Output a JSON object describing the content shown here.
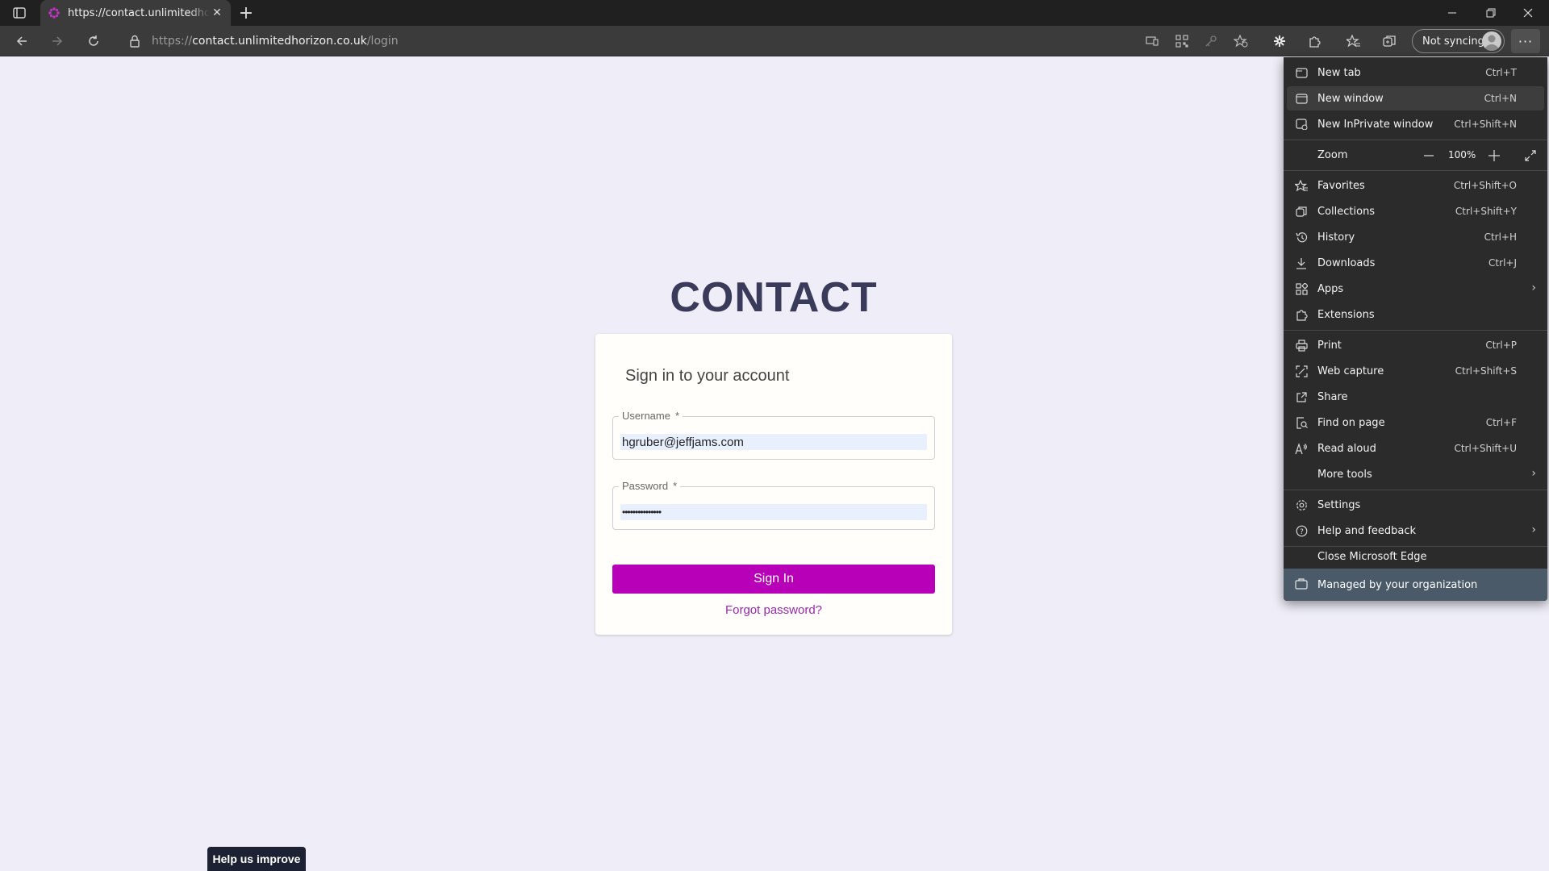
{
  "browser": {
    "tab_title": "https://contact.unlimitedhorizon.co.uk/login",
    "address_scheme": "https://",
    "address_host": "contact.unlimitedhorizon.co.uk",
    "address_path": "/login",
    "sync_label": "Not syncing",
    "more_label": "···"
  },
  "page": {
    "brand": "CONTACT",
    "card_title": "Sign in to your account",
    "username_label": "Username",
    "username_required": "*",
    "username_value": "hgruber@jeffjams.com",
    "password_label": "Password",
    "password_required": "*",
    "password_value": "•••••••••••••••",
    "signin_label": "Sign In",
    "forgot_label": "Forgot password?",
    "help_label": "Help us improve"
  },
  "menu": {
    "new_tab": {
      "label": "New tab",
      "shortcut": "Ctrl+T"
    },
    "new_window": {
      "label": "New window",
      "shortcut": "Ctrl+N"
    },
    "new_inprivate": {
      "label": "New InPrivate window",
      "shortcut": "Ctrl+Shift+N"
    },
    "zoom": {
      "label": "Zoom",
      "value": "100%"
    },
    "favorites": {
      "label": "Favorites",
      "shortcut": "Ctrl+Shift+O"
    },
    "collections": {
      "label": "Collections",
      "shortcut": "Ctrl+Shift+Y"
    },
    "history": {
      "label": "History",
      "shortcut": "Ctrl+H"
    },
    "downloads": {
      "label": "Downloads",
      "shortcut": "Ctrl+J"
    },
    "apps": {
      "label": "Apps"
    },
    "extensions": {
      "label": "Extensions"
    },
    "print": {
      "label": "Print",
      "shortcut": "Ctrl+P"
    },
    "web_capture": {
      "label": "Web capture",
      "shortcut": "Ctrl+Shift+S"
    },
    "share": {
      "label": "Share"
    },
    "find": {
      "label": "Find on page",
      "shortcut": "Ctrl+F"
    },
    "read_aloud": {
      "label": "Read aloud",
      "shortcut": "Ctrl+Shift+U"
    },
    "more_tools": {
      "label": "More tools"
    },
    "settings": {
      "label": "Settings"
    },
    "help": {
      "label": "Help and feedback"
    },
    "close": {
      "label": "Close Microsoft Edge"
    },
    "managed": {
      "label": "Managed by your organization"
    }
  },
  "colors": {
    "accent": "#b800b8",
    "link": "#9c27b0",
    "page_bg": "#efeef8",
    "menu_bg": "#2b2b2b",
    "managed_bg": "#4b5a69"
  }
}
